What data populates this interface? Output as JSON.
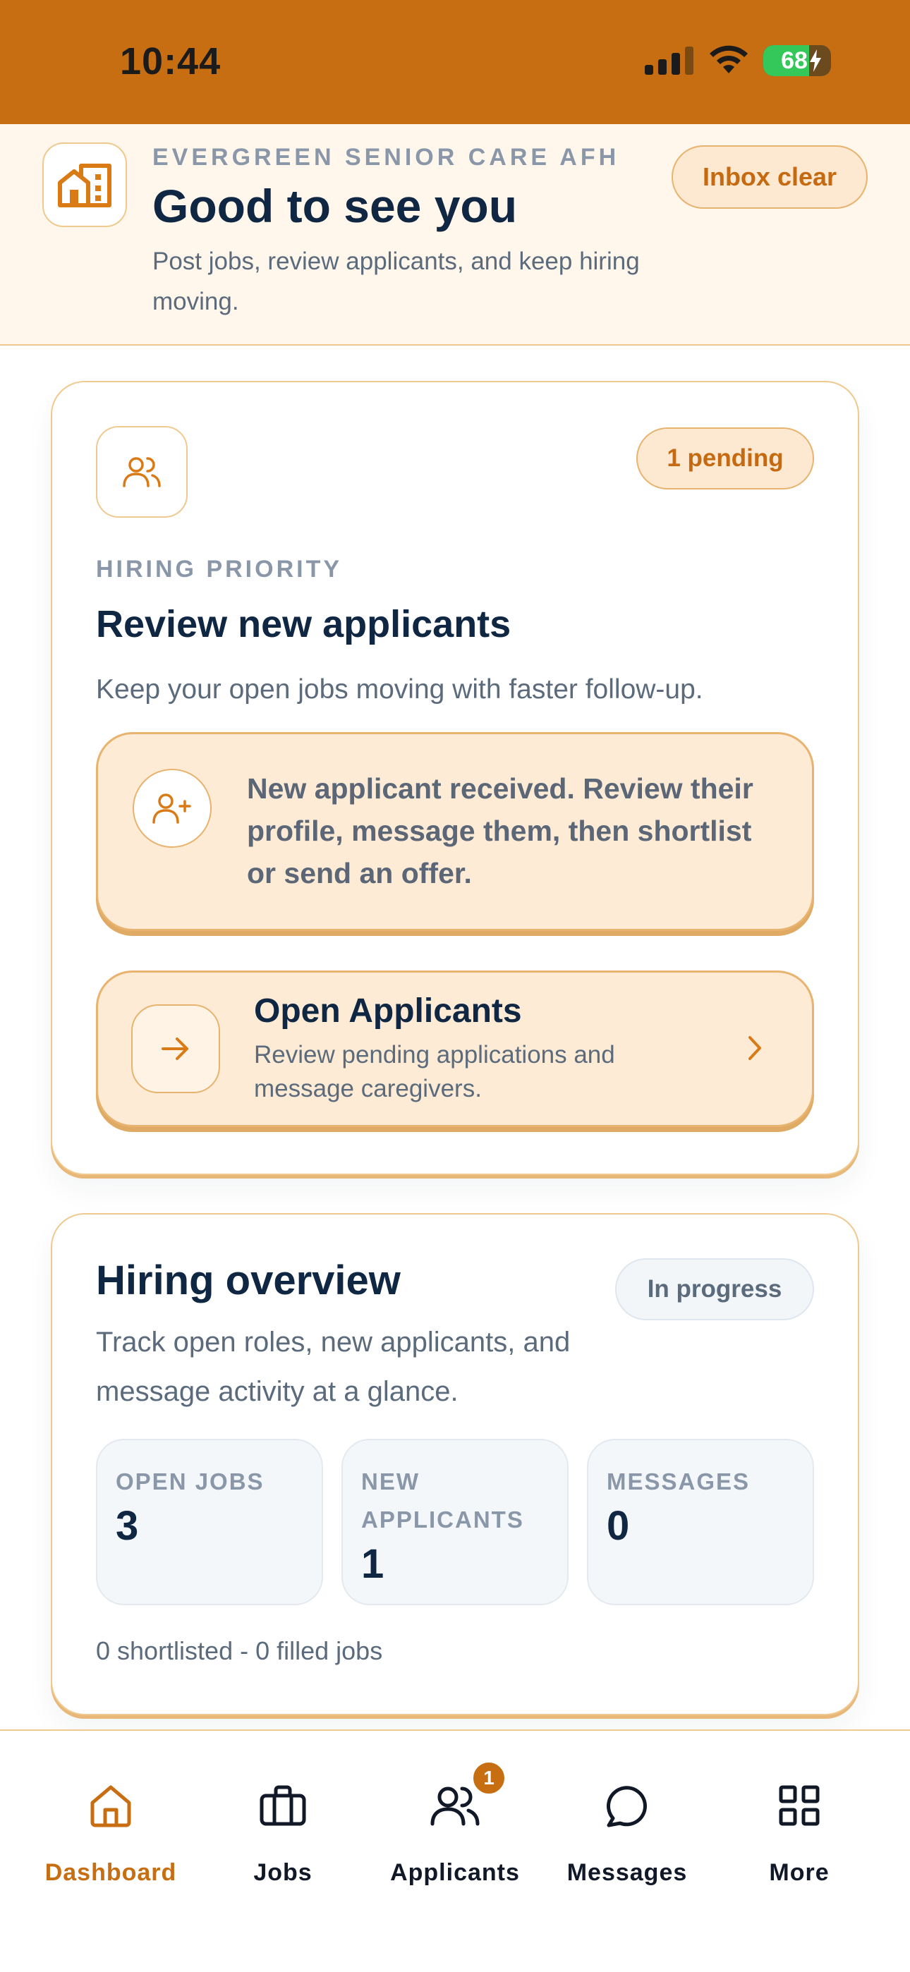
{
  "status_bar": {
    "time": "10:44",
    "battery_percent": "68",
    "battery_level": 0.68,
    "charging": true
  },
  "header": {
    "org_name": "EVERGREEN SENIOR CARE AFH",
    "greeting": "Good to see you",
    "subtitle": "Post jobs, review applicants, and keep hiring moving.",
    "inbox_status": "Inbox clear",
    "logo_icon": "building-icon"
  },
  "priority_card": {
    "icon": "users-icon",
    "pending_label": "1 pending",
    "kicker": "HIRING PRIORITY",
    "title": "Review new applicants",
    "description": "Keep your open jobs moving with faster follow-up.",
    "notice": {
      "icon": "user-plus-icon",
      "text": "New applicant received. Review their profile, message them, then shortlist or send an offer."
    },
    "action": {
      "icon": "arrow-right-icon",
      "title": "Open Applicants",
      "description": "Review pending applications and message caregivers.",
      "chevron": "chevron-right-icon"
    }
  },
  "overview_card": {
    "title": "Hiring overview",
    "status": "In progress",
    "description": "Track open roles, new applicants, and message activity at a glance.",
    "stats": [
      {
        "label": "OPEN JOBS",
        "value": "3"
      },
      {
        "label": "NEW APPLICANTS",
        "value": "1"
      },
      {
        "label": "MESSAGES",
        "value": "0"
      }
    ],
    "footer": "0 shortlisted - 0 filled jobs"
  },
  "tab_bar": {
    "tabs": [
      {
        "label": "Dashboard",
        "icon": "home-icon",
        "active": true
      },
      {
        "label": "Jobs",
        "icon": "briefcase-icon",
        "active": false
      },
      {
        "label": "Applicants",
        "icon": "users-icon",
        "active": false,
        "badge": "1"
      },
      {
        "label": "Messages",
        "icon": "message-icon",
        "active": false
      },
      {
        "label": "More",
        "icon": "grid-icon",
        "active": false
      }
    ]
  },
  "colors": {
    "accent": "#c76e12",
    "accent_soft": "#fdebd6",
    "border": "#f0c98f",
    "text_dark": "#0f2742",
    "text_muted": "#5b6b7c"
  }
}
